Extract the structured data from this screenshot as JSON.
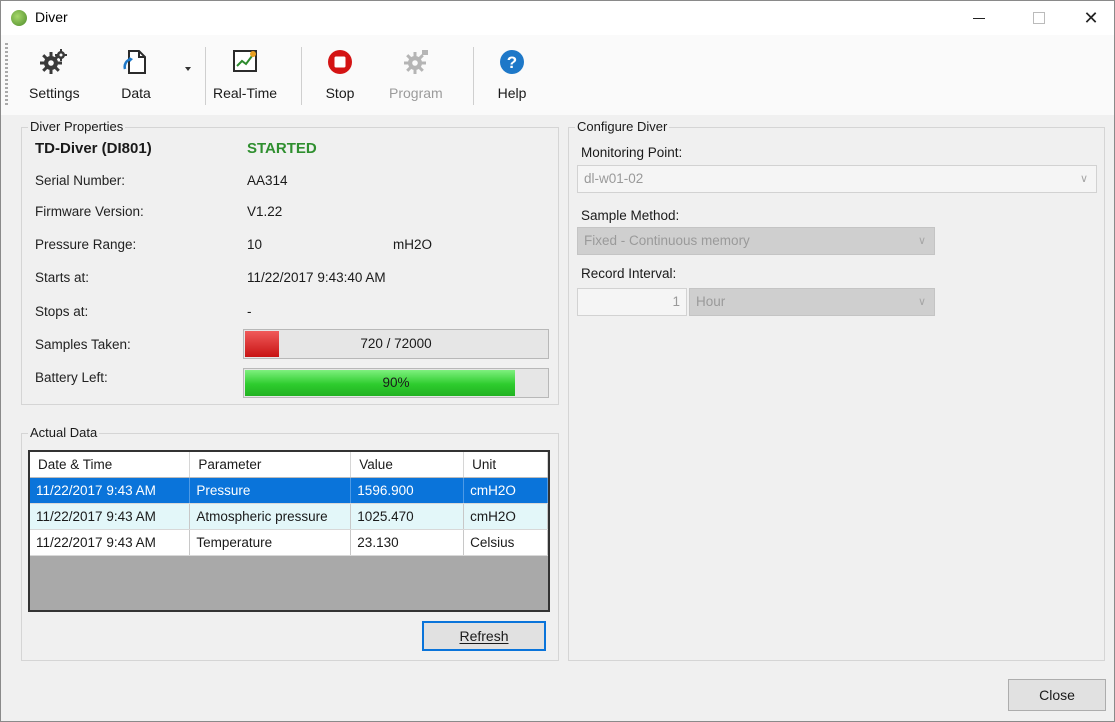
{
  "window": {
    "title": "Diver"
  },
  "toolbar": {
    "settings": "Settings",
    "data": "Data",
    "realtime": "Real-Time",
    "stop": "Stop",
    "program": "Program",
    "help": "Help"
  },
  "properties": {
    "title": "Diver Properties",
    "device": "TD-Diver (DI801)",
    "status": "STARTED",
    "serial_label": "Serial Number:",
    "serial": "AA314",
    "firmware_label": "Firmware Version:",
    "firmware": "V1.22",
    "pressure_label": "Pressure Range:",
    "pressure": "10",
    "pressure_unit": "mH2O",
    "starts_label": "Starts at:",
    "starts": "11/22/2017 9:43:40 AM",
    "stops_label": "Stops at:",
    "stops": "-",
    "samples_label": "Samples Taken:",
    "samples": "720 / 72000",
    "samples_fraction": 0.01,
    "battery_label": "Battery Left:",
    "battery": "90%",
    "battery_fraction": 0.9
  },
  "actual": {
    "title": "Actual Data",
    "columns": [
      "Date & Time",
      "Parameter",
      "Value",
      "Unit"
    ],
    "rows": [
      [
        "11/22/2017 9:43 AM",
        "Pressure",
        "1596.900",
        "cmH2O"
      ],
      [
        "11/22/2017 9:43 AM",
        "Atmospheric pressure",
        "1025.470",
        "cmH2O"
      ],
      [
        "11/22/2017 9:43 AM",
        "Temperature",
        "23.130",
        "Celsius"
      ]
    ],
    "refresh": "Refresh"
  },
  "configure": {
    "title": "Configure Diver",
    "mp_label": "Monitoring Point:",
    "mp_value": "dl-w01-02",
    "sm_label": "Sample Method:",
    "sm_value": "Fixed - Continuous memory",
    "ri_label": "Record Interval:",
    "ri_value": "1",
    "ri_unit": "Hour"
  },
  "footer": {
    "close": "Close"
  },
  "colors": {
    "accent": "#0a74da",
    "started": "#2f8f2f",
    "battery": "#2ecc2e",
    "samples": "#d42020"
  }
}
